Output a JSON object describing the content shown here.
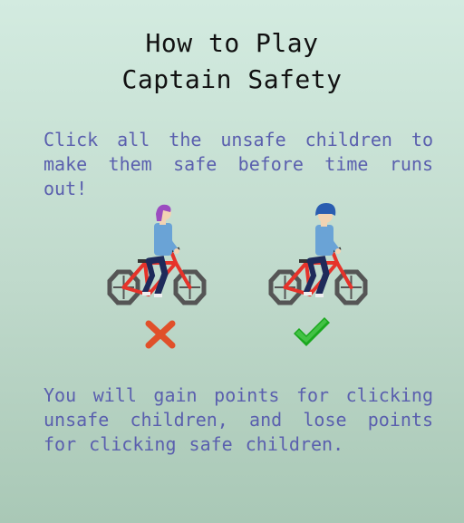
{
  "title": {
    "line1": "How to Play",
    "line2": "Captain Safety"
  },
  "instructions": "Click all the unsafe children to make them safe before time runs out!",
  "scoring": "You will gain points for clicking unsafe children, and lose points for clicking safe children.",
  "colors": {
    "instruction_text": "#5a5fae",
    "unsafe_mark": "#e0502a",
    "safe_mark": "#1aa81e",
    "bike_frame": "#e6332a",
    "wheel": "#555555"
  },
  "examples": [
    {
      "label": "unsafe",
      "icon": "x-mark-icon"
    },
    {
      "label": "safe",
      "icon": "check-mark-icon"
    }
  ]
}
